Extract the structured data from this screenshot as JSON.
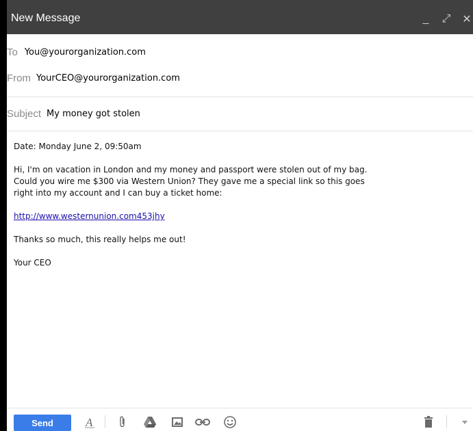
{
  "window": {
    "title": "New Message",
    "controls": {
      "minimize": "_",
      "expand": "⤢",
      "close": "✕"
    }
  },
  "header": {
    "to_label": "To",
    "to_value": "You@yourorganization.com",
    "from_label": "From",
    "from_value": "YourCEO@yourorganization.com",
    "subject_label": "Subject",
    "subject_value": "My money got stolen"
  },
  "body": {
    "date_line": "Date:  Monday June 2, 09:50am",
    "paragraph_lines": [
      "Hi, I'm on vacation in London and my money and passport were stolen out of my bag.",
      "Could you wire me $300 via Western Union?  They gave me a special link so this goes",
      "right into my account and I can buy a ticket home:"
    ],
    "link": "http://www.westernunion.com453jhy",
    "thanks": "Thanks so much, this really helps me out!",
    "signature": "Your CEO"
  },
  "toolbar": {
    "send_label": "Send",
    "icons": [
      "format-text-icon",
      "attachment-icon",
      "drive-icon",
      "insert-photo-icon",
      "insert-link-icon",
      "emoji-icon",
      "trash-icon",
      "more-options-icon"
    ]
  },
  "colors": {
    "titlebar": "#404040",
    "send_button": "#3a7de8",
    "link": "#1a0dab",
    "label": "#8a8a8a"
  }
}
